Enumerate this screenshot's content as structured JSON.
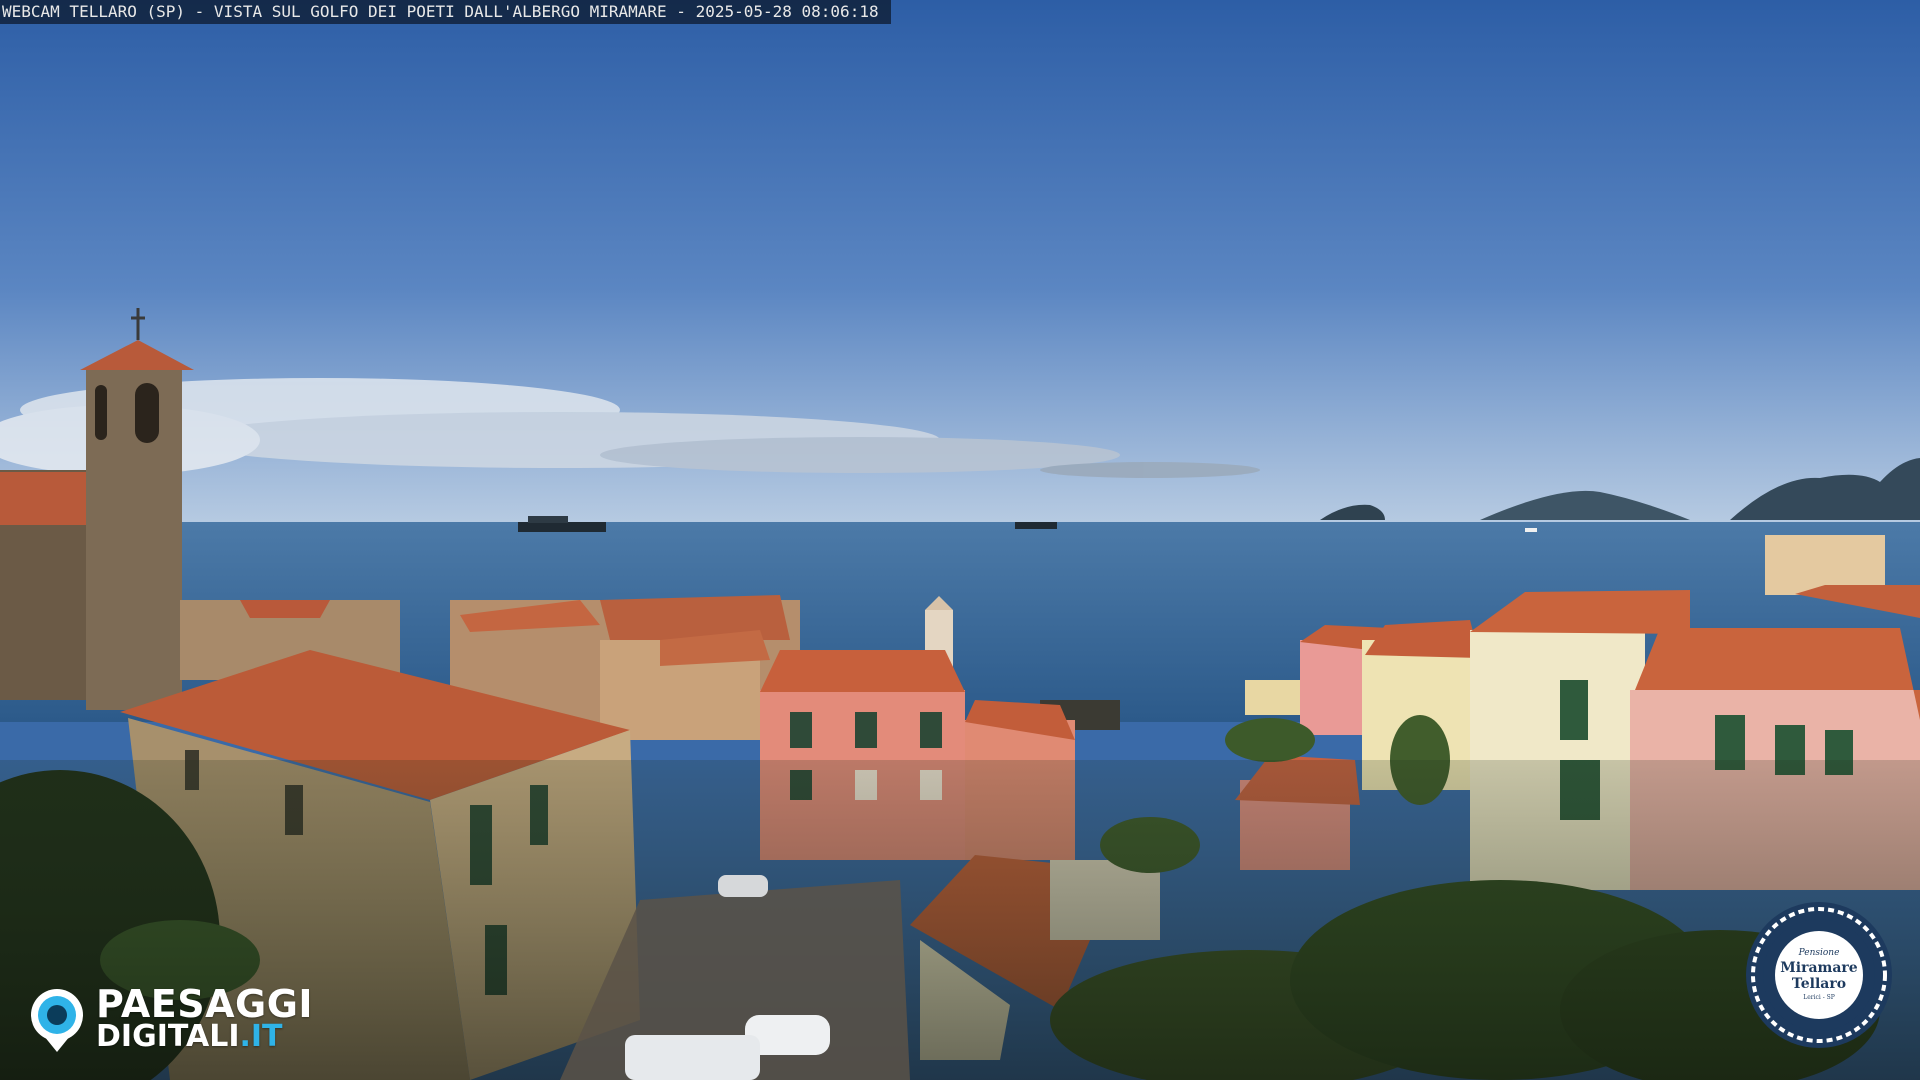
{
  "caption": "WEBCAM TELLARO (SP) - VISTA SUL GOLFO DEI POETI DALL'ALBERGO MIRAMARE - 2025-05-28 08:06:18",
  "logo": {
    "line1": "PAESAGGI",
    "line2": "DIGITALI",
    "tld": ".IT"
  },
  "badge": {
    "small": "Pensione",
    "name_line1": "Miramare",
    "name_line2": "Tellaro",
    "tiny": "Lerici - SP"
  },
  "colors": {
    "sky_top": "#2f5fa3",
    "sky_bottom": "#a9c1dc",
    "sea": "#3a6a98",
    "roof": "#c7603c",
    "logo_tld": "#2fb3e8",
    "badge_navy": "#1d3a5e"
  }
}
